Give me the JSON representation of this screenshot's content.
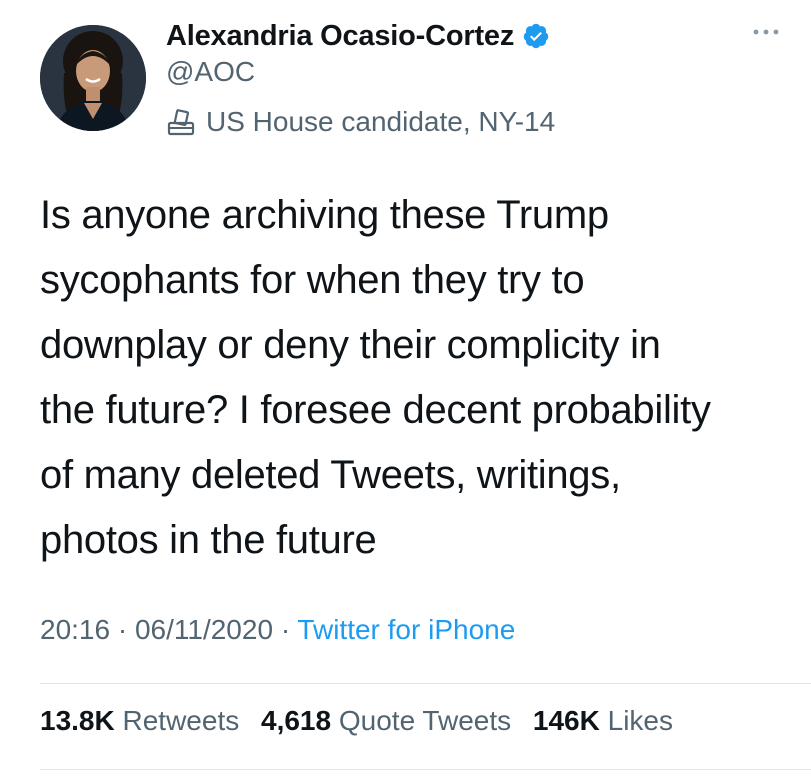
{
  "author": {
    "display_name": "Alexandria Ocasio-Cortez",
    "handle": "@AOC",
    "label": "US House candidate, NY-14",
    "verified": true
  },
  "tweet": {
    "text_lines": [
      "Is anyone archiving these Trump",
      "sycophants for when they try to",
      "downplay or deny their complicity in",
      "the future? I foresee decent probability",
      "of many deleted Tweets, writings,",
      "photos in the future"
    ]
  },
  "meta": {
    "time": "20:16",
    "separator": "·",
    "date": "06/11/2020",
    "source": "Twitter for iPhone"
  },
  "stats": {
    "retweets_count": "13.8K",
    "retweets_label": "Retweets",
    "quotes_count": "4,618",
    "quotes_label": "Quote Tweets",
    "likes_count": "146K",
    "likes_label": "Likes"
  },
  "icons": {
    "verified": "verified-badge-icon",
    "label": "ballot-box-icon",
    "more": "more-options-icon"
  },
  "colors": {
    "verified_blue": "#1d9bf0",
    "link_blue": "#1d9bf0",
    "secondary_text": "#536471",
    "primary_text": "#0f1419"
  }
}
